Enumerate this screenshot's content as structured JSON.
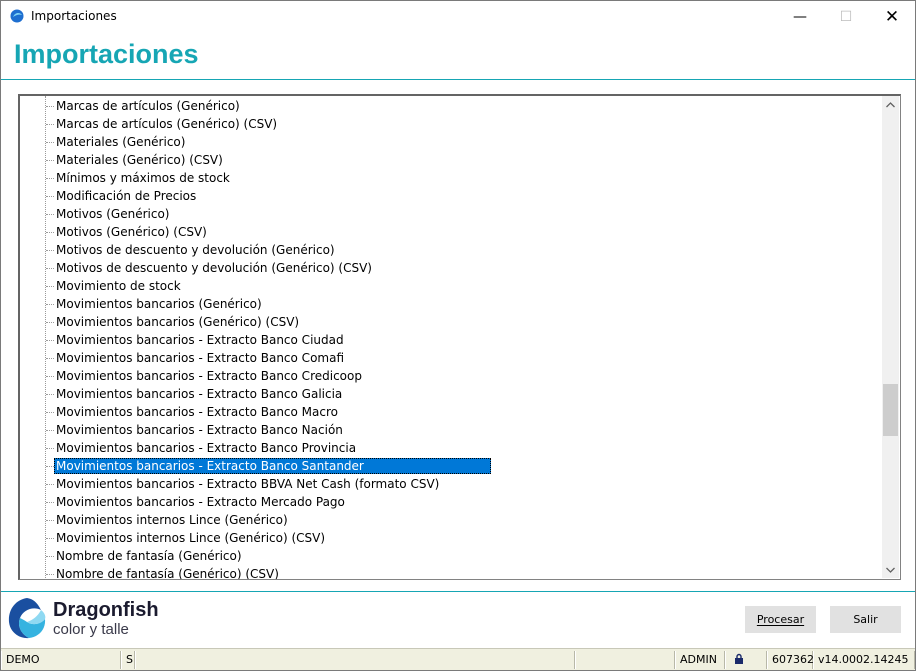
{
  "window": {
    "title": "Importaciones",
    "minimize_glyph": "—",
    "maximize_glyph": "☐",
    "close_glyph": "✕"
  },
  "header": {
    "title": "Importaciones",
    "accent_color": "#16a6b4"
  },
  "tree": {
    "items": [
      {
        "label": "Marcas de artículos (Genérico)",
        "selected": false
      },
      {
        "label": "Marcas de artículos (Genérico) (CSV)",
        "selected": false
      },
      {
        "label": "Materiales (Genérico)",
        "selected": false
      },
      {
        "label": "Materiales (Genérico) (CSV)",
        "selected": false
      },
      {
        "label": "Mínimos y máximos de stock",
        "selected": false
      },
      {
        "label": "Modificación de Precios",
        "selected": false
      },
      {
        "label": "Motivos (Genérico)",
        "selected": false
      },
      {
        "label": "Motivos (Genérico) (CSV)",
        "selected": false
      },
      {
        "label": "Motivos de descuento y devolución (Genérico)",
        "selected": false
      },
      {
        "label": "Motivos de descuento y devolución (Genérico) (CSV)",
        "selected": false
      },
      {
        "label": "Movimiento de stock",
        "selected": false
      },
      {
        "label": "Movimientos bancarios (Genérico)",
        "selected": false
      },
      {
        "label": "Movimientos bancarios (Genérico) (CSV)",
        "selected": false
      },
      {
        "label": "Movimientos bancarios - Extracto Banco Ciudad",
        "selected": false
      },
      {
        "label": "Movimientos bancarios - Extracto Banco Comafi",
        "selected": false
      },
      {
        "label": "Movimientos bancarios - Extracto Banco Credicoop",
        "selected": false
      },
      {
        "label": "Movimientos bancarios - Extracto Banco Galicia",
        "selected": false
      },
      {
        "label": "Movimientos bancarios - Extracto Banco Macro",
        "selected": false
      },
      {
        "label": "Movimientos bancarios - Extracto Banco Nación",
        "selected": false
      },
      {
        "label": "Movimientos bancarios - Extracto Banco Provincia",
        "selected": false
      },
      {
        "label": "Movimientos bancarios - Extracto Banco Santander",
        "selected": true
      },
      {
        "label": "Movimientos bancarios - Extracto BBVA Net Cash (formato CSV)",
        "selected": false
      },
      {
        "label": "Movimientos bancarios - Extracto Mercado Pago",
        "selected": false
      },
      {
        "label": "Movimientos internos Lince (Genérico)",
        "selected": false
      },
      {
        "label": "Movimientos internos Lince (Genérico) (CSV)",
        "selected": false
      },
      {
        "label": "Nombre de fantasía (Genérico)",
        "selected": false
      },
      {
        "label": "Nombre de fantasía (Genérico) (CSV)",
        "selected": false
      }
    ],
    "selection_color": "#0078d7",
    "scroll_position": 0.6
  },
  "brand": {
    "name": "Dragonfish",
    "tagline": "color y talle"
  },
  "buttons": {
    "procesar": "Procesar",
    "salir": "Salir"
  },
  "statusbar": {
    "mode": "DEMO",
    "flag": "S",
    "user": "ADMIN",
    "lock_icon": "lock-icon",
    "number": "607362",
    "version": "v14.0002.14245"
  }
}
